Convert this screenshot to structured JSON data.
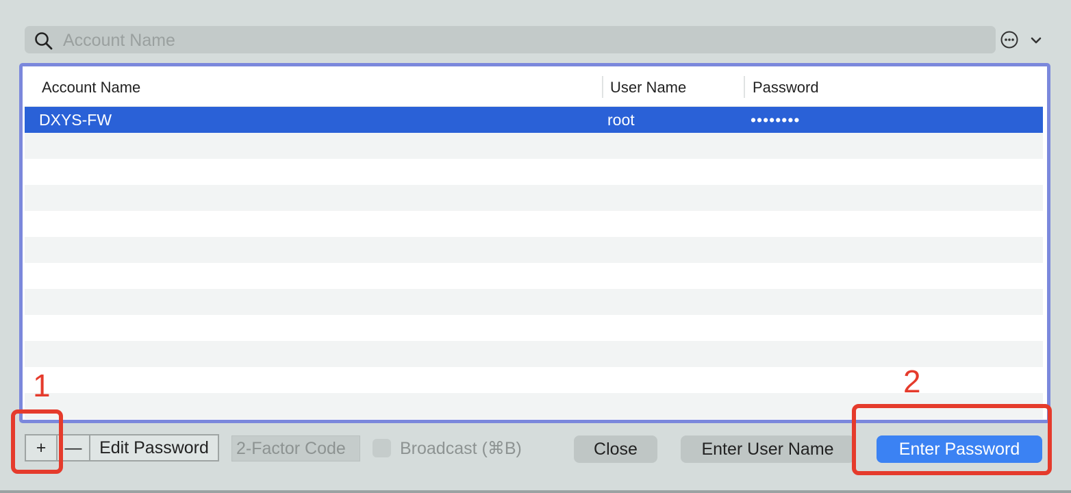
{
  "search": {
    "placeholder": "Account Name"
  },
  "table": {
    "columns": [
      "Account Name",
      "User Name",
      "Password"
    ],
    "rows": [
      {
        "account": "DXYS-FW",
        "user": "root",
        "password": "••••••••",
        "selected": true
      }
    ]
  },
  "toolbar": {
    "add_label": "+",
    "remove_label": "—",
    "edit_password_label": "Edit Password",
    "two_factor_placeholder": "2-Factor Code",
    "broadcast_label": "Broadcast (⌘B)",
    "close_label": "Close",
    "enter_user_name_label": "Enter User Name",
    "enter_password_label": "Enter Password"
  },
  "annotations": {
    "first": "1",
    "second": "2"
  },
  "colors": {
    "selection": "#2a61d7",
    "table_border": "#7b88dc",
    "primary_button": "#3b82f3",
    "annotation": "#e53b2c"
  }
}
